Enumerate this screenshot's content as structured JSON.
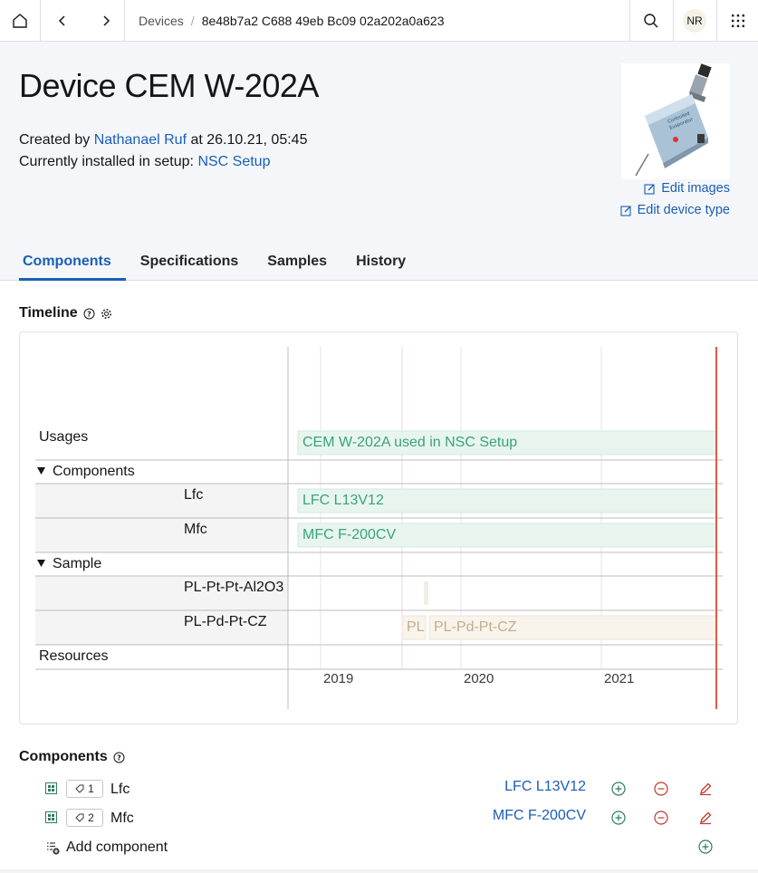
{
  "breadcrumb": {
    "root": "Devices",
    "current": "8e48b7a2 C688 49eb Bc09 02a202a0a623"
  },
  "user": {
    "initials": "NR"
  },
  "device": {
    "title": "Device CEM W-202A",
    "created_prefix": "Created by ",
    "creator": "Nathanael Ruf",
    "created_suffix": " at 26.10.21, 05:45",
    "installed_prefix": "Currently installed in setup: ",
    "setup": "NSC Setup"
  },
  "actions": {
    "edit_images": "Edit images",
    "edit_device_type": "Edit device type"
  },
  "tabs": [
    "Components",
    "Specifications",
    "Samples",
    "History"
  ],
  "timeline": {
    "title": "Timeline",
    "years": [
      "2019",
      "2020",
      "2021"
    ],
    "rows": {
      "usages": "Usages",
      "components_group": "Components",
      "lfc": "Lfc",
      "mfc": "Mfc",
      "sample_group": "Sample",
      "sample1": "PL-Pt-Pt-Al2O3",
      "sample2": "PL-Pd-Pt-CZ",
      "resources": "Resources"
    },
    "bars": {
      "usage": "CEM W-202A used in NSC Setup",
      "lfc": "LFC L13V12",
      "mfc": "MFC F-200CV",
      "sample2_short": "PL",
      "sample2": "PL-Pd-Pt-CZ"
    }
  },
  "components": {
    "title": "Components",
    "items": [
      {
        "index": "1",
        "name": "Lfc",
        "value": "LFC L13V12"
      },
      {
        "index": "2",
        "name": "Mfc",
        "value": "MFC F-200CV"
      }
    ],
    "add_label": "Add component"
  },
  "colors": {
    "accent": "#1a5fb4",
    "usage_bar": "#e8f5ef",
    "usage_text": "#3aa37a",
    "sample_bar": "#f8f4ec",
    "sample_text": "#c4ae8a",
    "now_line": "#e05a47"
  }
}
